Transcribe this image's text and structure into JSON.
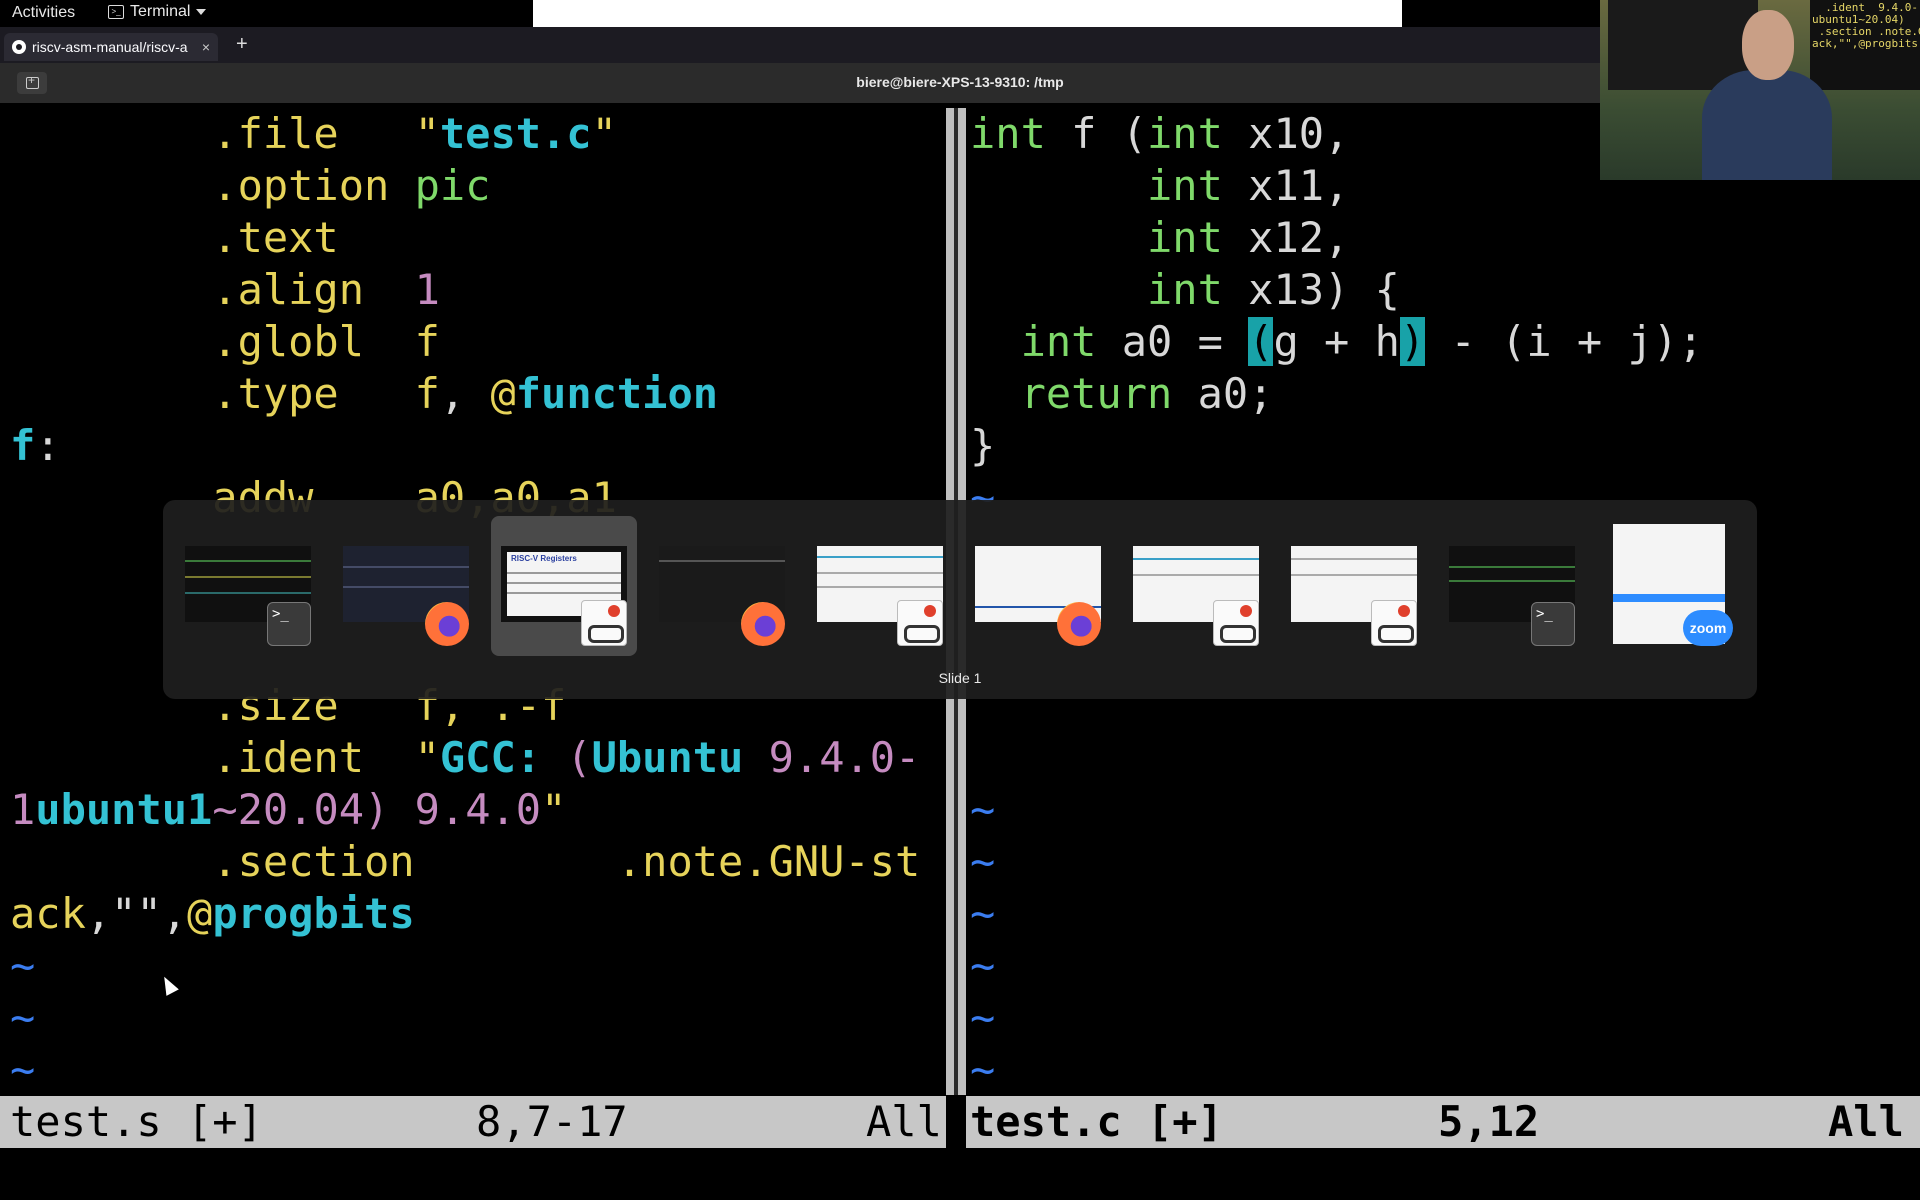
{
  "topbar": {
    "activities": "Activities",
    "app_menu": "Terminal"
  },
  "browser": {
    "tab_title": "riscv-asm-manual/riscv-a",
    "new_tab": "+",
    "close": "×"
  },
  "terminal": {
    "title": "biere@biere-XPS-13-9310: /tmp"
  },
  "left_pane": {
    "lines": {
      "l1": {
        "a": "        .file   ",
        "b": "\"",
        "c": "test.c",
        "d": "\""
      },
      "l2": {
        "a": "        .option ",
        "b": "pic"
      },
      "l3": {
        "a": "        .text"
      },
      "l4": {
        "a": "        .align  ",
        "b": "1"
      },
      "l5": {
        "a": "        .globl  ",
        "b": "f"
      },
      "l6": {
        "a": "        .type   ",
        "b": "f",
        "c": ", ",
        "d": "@",
        "e": "function"
      },
      "l7": {
        "a": "f",
        "b": ":"
      },
      "l8": {
        "a": "        addw    ",
        "b": "a0,a0,a1"
      },
      "l12": {
        "a": "        .size   ",
        "b": "f, .-f"
      },
      "l13": {
        "a": "        .ident  ",
        "b": "\"",
        "c": "GCC: ",
        "d": "(",
        "e": "Ubuntu ",
        "f": "9.4.0-"
      },
      "l14": {
        "a": "1",
        "b": "ubuntu1",
        "c": "~",
        "d": "20.04",
        "e": ") ",
        "f": "9.4.0",
        "g": "\""
      },
      "l15": {
        "a": "        .section        .note.GNU-st"
      },
      "l16": {
        "a": "ack",
        "b": ",",
        "c": "\"\"",
        "d": ",",
        "e": "@",
        "f": "progbits"
      },
      "tilde": "~"
    },
    "status": {
      "file": "test.s [+]",
      "pos": "8,7-17",
      "scope": "All"
    }
  },
  "right_pane": {
    "lines": {
      "l1": {
        "a": "int",
        "b": " f (",
        "c": "int",
        "d": " x10,"
      },
      "l2": {
        "a": "       ",
        "b": "int",
        "c": " x11,"
      },
      "l3": {
        "a": "       ",
        "b": "int",
        "c": " x12,"
      },
      "l4": {
        "a": "       ",
        "b": "int",
        "c": " x13) {"
      },
      "l5": {
        "a": "  ",
        "b": "int",
        "c": " a0 = ",
        "d": "(",
        "e": "g + h",
        "f": ")",
        "g": " - (i + j);"
      },
      "l6": {
        "a": "  ",
        "b": "return",
        "c": " a0;"
      },
      "l7": {
        "a": "}"
      },
      "tilde": "~"
    },
    "status": {
      "file": "test.c [+]",
      "pos": "5,12",
      "scope": "All"
    }
  },
  "webcam": {
    "overlay_text": "  .ident  9.4.0-\nubuntu1~20.04)\n .section .note.GNU-st\nack,\"\",@progbits"
  },
  "switcher": {
    "caption": "Slide 1",
    "selected_index": 2,
    "items": [
      {
        "app": "terminal-icon",
        "label": ">_"
      },
      {
        "app": "firefox-icon"
      },
      {
        "app": "document-viewer-icon",
        "preview_title": "RISC-V Registers"
      },
      {
        "app": "firefox-icon"
      },
      {
        "app": "document-viewer-icon"
      },
      {
        "app": "firefox-icon"
      },
      {
        "app": "document-viewer-icon"
      },
      {
        "app": "document-viewer-icon"
      },
      {
        "app": "terminal-icon",
        "label": ">_"
      },
      {
        "app": "zoom-icon",
        "label": "zoom"
      }
    ]
  }
}
